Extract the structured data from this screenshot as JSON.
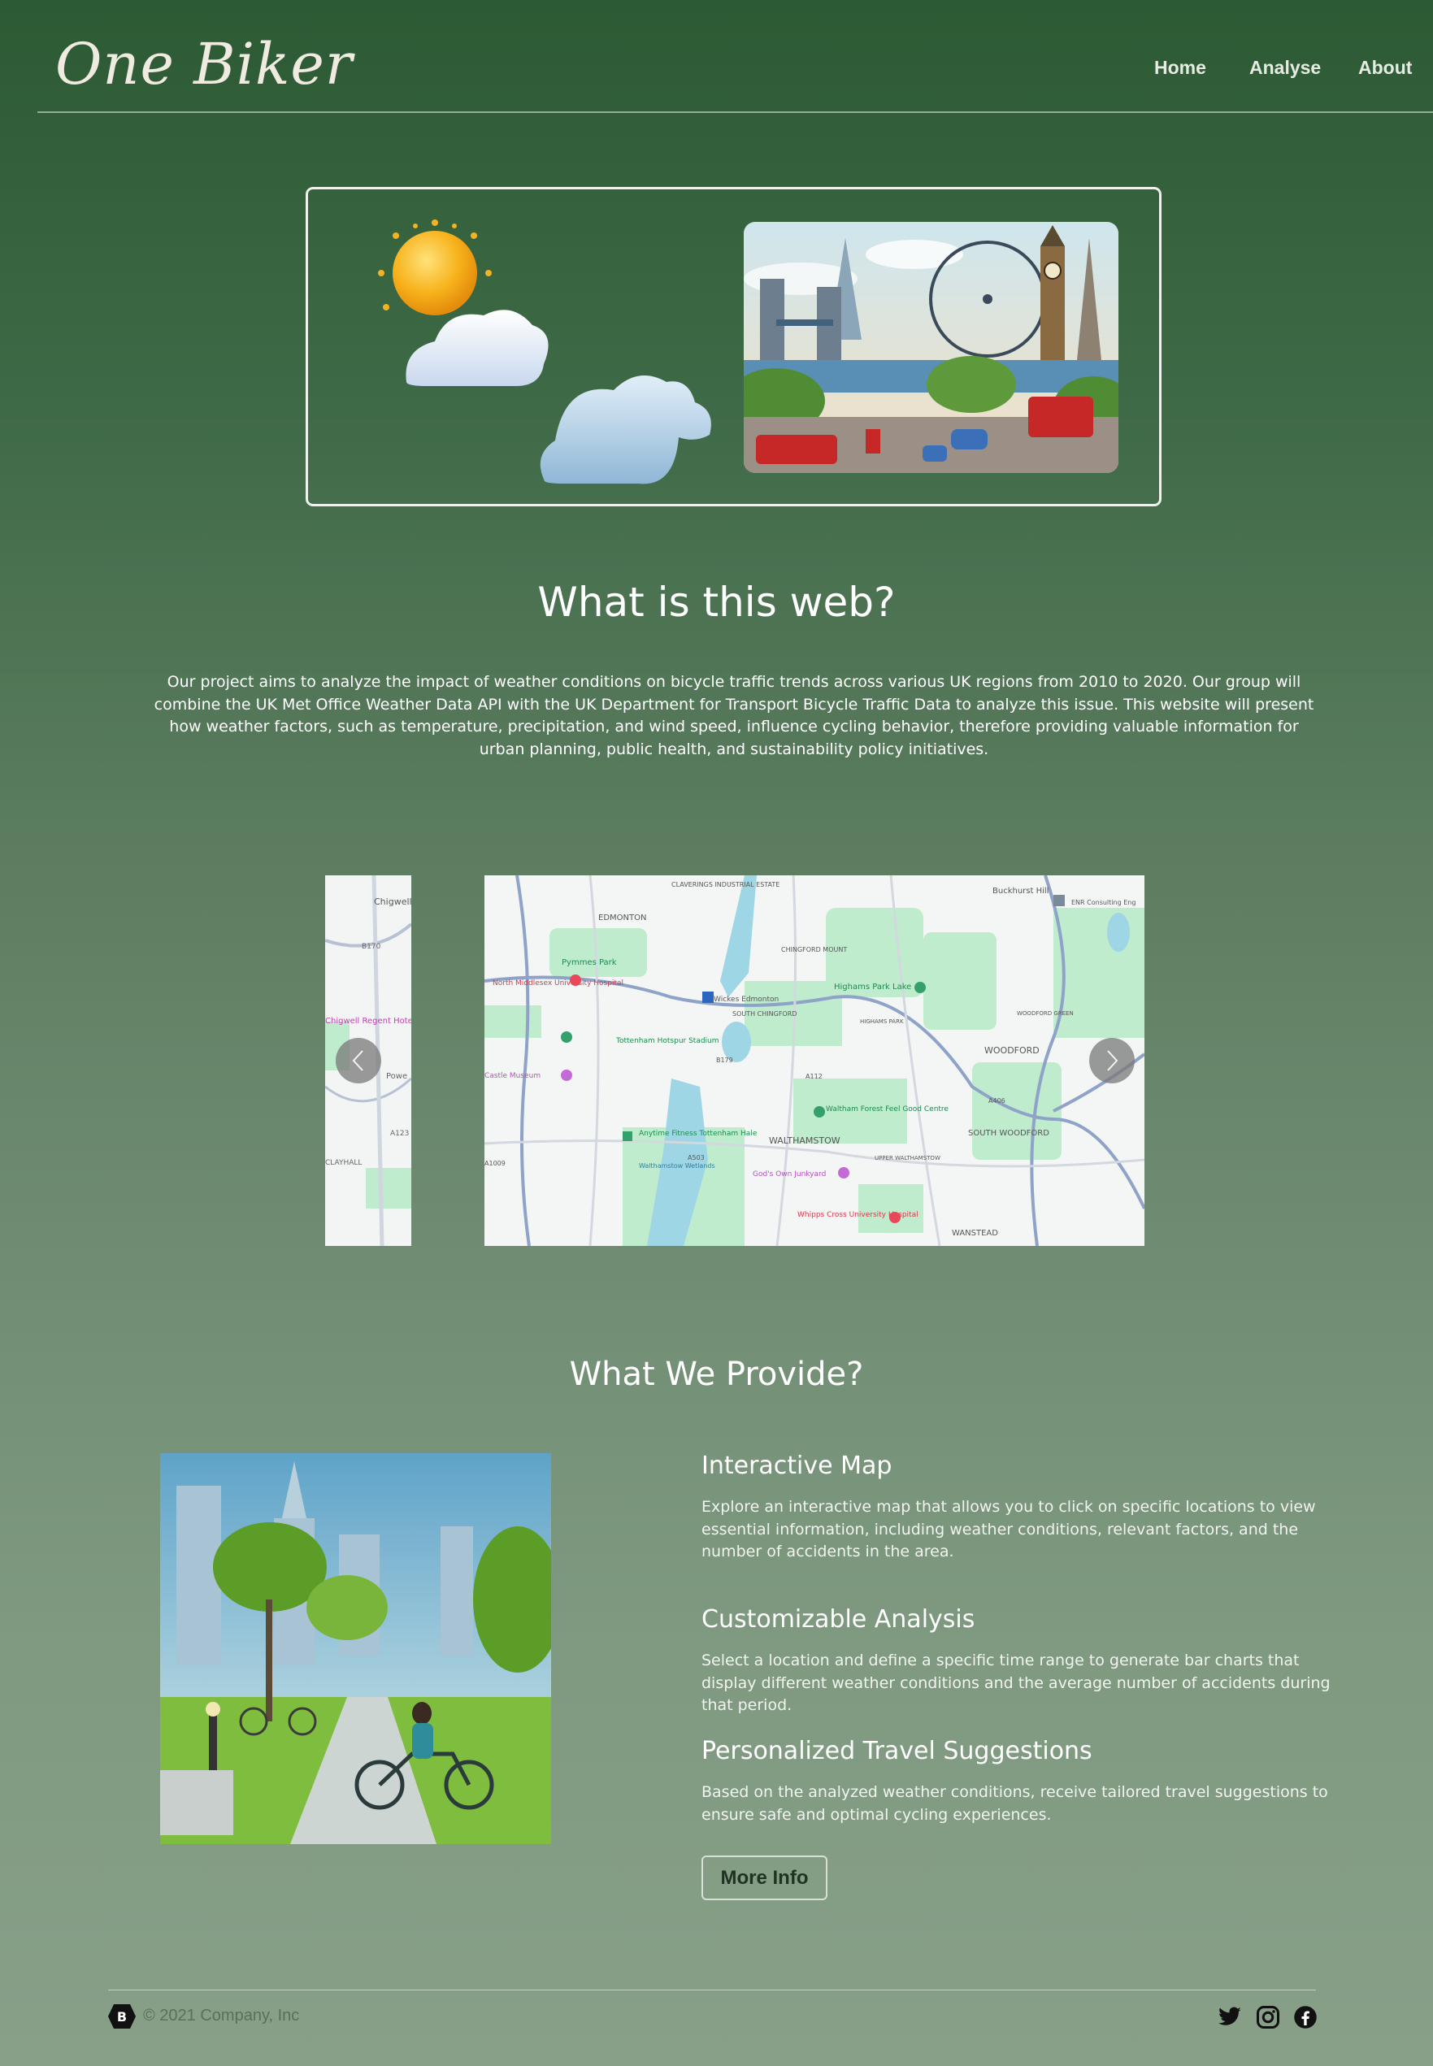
{
  "header": {
    "brand": "One Biker",
    "nav": [
      "Home",
      "Analyse",
      "About"
    ]
  },
  "intro": {
    "title": "What is this web?",
    "text": "Our project aims to analyze the impact of weather conditions on bicycle traffic trends across various UK regions from 2010 to 2020. Our group will combine the UK Met Office Weather Data API with the UK Department for Transport Bicycle Traffic Data to analyze this issue. This website will present how weather factors, such as temperature, precipitation, and wind speed, influence cycling behavior, therefore providing valuable information for urban planning, public health, and sustainability policy initiatives."
  },
  "map": {
    "left_labels": [
      "Chigwell",
      "B170",
      "Chigwell Regent Hotel",
      "Powe",
      "A123",
      "CLAYHALL"
    ],
    "labels": [
      "CLAVERINGS INDUSTRIAL ESTATE",
      "EDMONTON",
      "Buckhurst Hill",
      "ENR Consulting Eng",
      "Pymmes Park",
      "North Middlesex University Hospital",
      "Wickes Edmonton",
      "CHINGFORD MOUNT",
      "SOUTH CHINGFORD",
      "Highams Park Lake",
      "HIGHAMS PARK",
      "WOODFORD GREEN",
      "Tottenham Hotspur Stadium",
      "Castle Museum",
      "WOODFORD",
      "Waltham Forest Feel Good Centre",
      "Anytime Fitness Tottenham Hale",
      "WALTHAMSTOW",
      "SOUTH WOODFORD",
      "Walthamstow Wetlands",
      "God's Own Junkyard",
      "UPPER WALTHAMSTOW",
      "Whipps Cross University Hospital",
      "WANSTEAD",
      "B179",
      "A406",
      "A503",
      "A112",
      "A1009"
    ]
  },
  "provide": {
    "title": "What We Provide?",
    "features": [
      {
        "title": "Interactive Map",
        "text": "Explore an interactive map that allows you to click on specific locations to view essential information, including weather conditions, relevant factors, and the number of accidents in the area."
      },
      {
        "title": "Customizable Analysis",
        "text": "Select a location and define a specific time range to generate bar charts that display different weather conditions and the average number of accidents during that period."
      },
      {
        "title": "Personalized Travel Suggestions",
        "text": "Based on the analyzed weather conditions, receive tailored travel suggestions to ensure safe and optimal cycling experiences."
      }
    ],
    "button": "More Info"
  },
  "footer": {
    "logo_letter": "B",
    "copyright": "© 2021 Company, Inc",
    "social": [
      "twitter-icon",
      "instagram-icon",
      "facebook-icon"
    ]
  },
  "colors": {
    "bg_top": "#2c5a33",
    "bg_bottom": "#889f88",
    "map_park": "#a8e6be",
    "map_water": "#9ed8e8",
    "hospital": "#e8485a",
    "museum": "#c36ad6"
  }
}
